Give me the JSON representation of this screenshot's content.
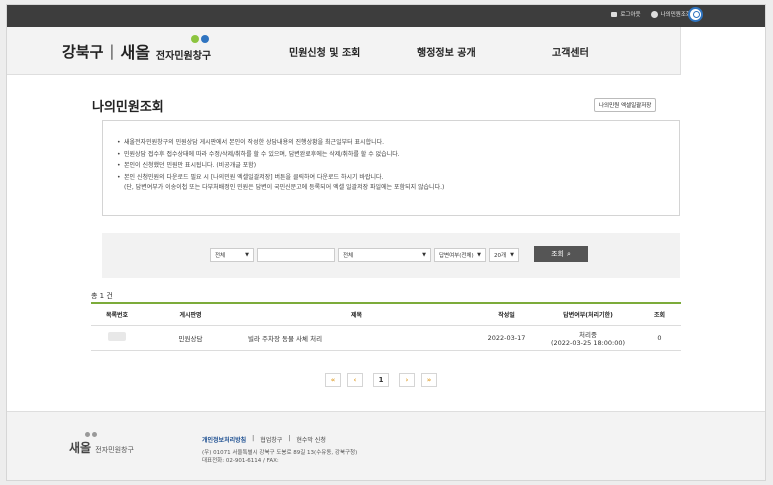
{
  "utility": {
    "login": "로그아웃",
    "my": "나의민원조회"
  },
  "header": {
    "district": "강북구",
    "separator": "|",
    "brand": "새올",
    "subtitle": "전자민원창구"
  },
  "nav": [
    "민원신청 및 조회",
    "행정정보 공개",
    "고객센터"
  ],
  "page": {
    "title": "나의민원조회",
    "excel_button": "나의민원 엑셀일괄저장"
  },
  "notice": [
    "새올전자민원창구의 민원상담 게시판에서 본인이 작성한 상담내용의 진행상황을 최근일부터 표시합니다.",
    "민원상담 접수후 접수상태에 따라 수정/삭제/취하를 할 수 있으며, 답변완료후에는 삭제/취하를 할 수 없습니다.",
    "본인이 신청했던 민원만 표시됩니다. (비공개글 포함)",
    "본인 신청민원의 다운로드 필요 시 [나의민원 엑셀일괄저장] 버튼을 클릭하여 다운로드 하시기 바랍니다."
  ],
  "notice_indent": "(단, 답변여부가 이송이첩 또는 다부처배정인 민원은 답변이 국민신문고에 등록되어 엑셀 일괄저장 파일에는 포함되지 않습니다.)",
  "filter": {
    "select1": "전체",
    "input_placeholder": "",
    "select2": "전체",
    "select3": "답변여부(전체)",
    "select4": "20개",
    "search_label": "조회"
  },
  "total": "총 1 건",
  "table": {
    "headers": [
      "목록번호",
      "게시판명",
      "제목",
      "작성일",
      "답변여부(처리기한)",
      "조회"
    ],
    "rows": [
      {
        "board": "민원상담",
        "title": "빌라 주차장 동물 사체 처리",
        "date": "2022-03-17",
        "status": "처리중",
        "deadline": "(2022-03-25 18:00:00)",
        "views": "0"
      }
    ]
  },
  "pager": {
    "first": "«",
    "prev": "‹",
    "current": "1",
    "next": "›",
    "last": "»"
  },
  "footer": {
    "brand": "새올",
    "brand_sub": "전자민원창구",
    "links": [
      "개인정보처리방침",
      "|",
      "협업창구",
      "|",
      "현수막 신청"
    ],
    "address": "(우) 01071 서울특별시 강북구 도봉로 89길 13(수유동, 강북구청)",
    "phone": "대표전화: 02-901-6114 / FAX:"
  },
  "colors": {
    "accent_green": "#7cab3a",
    "dot_green": "#8cc43f",
    "dot_blue": "#2f74c0",
    "pager_orange": "#e0a43a"
  }
}
